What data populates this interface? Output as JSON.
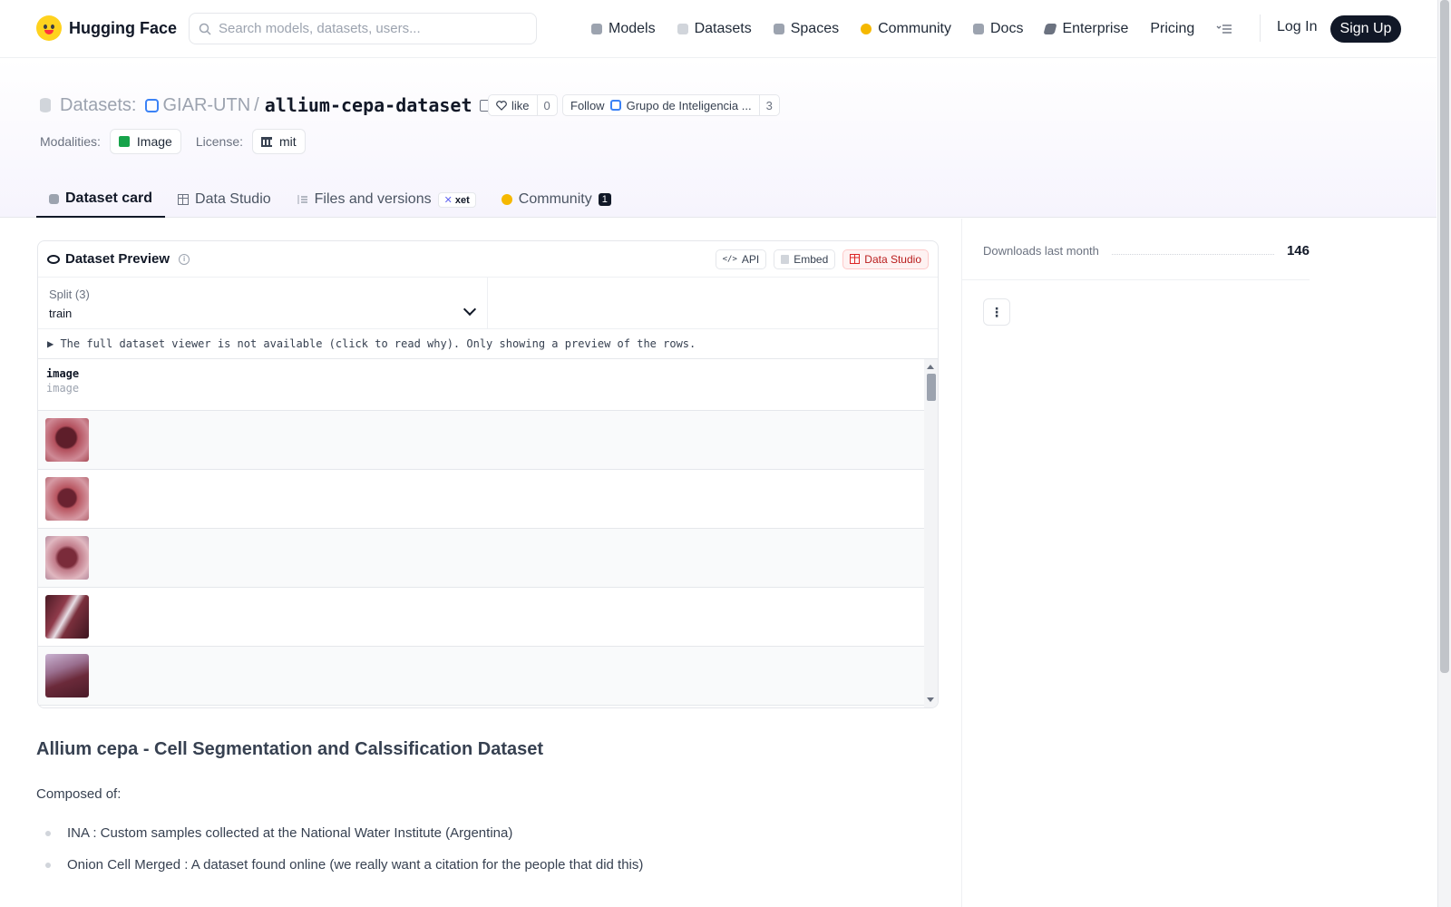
{
  "nav": {
    "brand": "Hugging Face",
    "search_placeholder": "Search models, datasets, users...",
    "links": [
      {
        "label": "Models",
        "icon": "cube-icon",
        "color": "#9ca3af"
      },
      {
        "label": "Datasets",
        "icon": "database-icon",
        "color": "#d1d5db"
      },
      {
        "label": "Spaces",
        "icon": "grid-icon",
        "color": "#9ca3af"
      },
      {
        "label": "Community",
        "icon": "hug-emoji-icon",
        "color": "#f5b800"
      },
      {
        "label": "Docs",
        "icon": "book-icon",
        "color": "#9ca3af"
      },
      {
        "label": "Enterprise",
        "icon": "enterprise-icon",
        "color": "#6b7280"
      },
      {
        "label": "Pricing",
        "icon": "",
        "color": ""
      }
    ],
    "login": "Log In",
    "signup": "Sign Up"
  },
  "header": {
    "section": "Datasets:",
    "org": "GIAR-UTN",
    "sep": "/",
    "repo": "allium-cepa-dataset",
    "like_label": "like",
    "like_count": "0",
    "follow_label": "Follow",
    "follow_org": "Grupo de Inteligencia ...",
    "follow_count": "3",
    "modalities_label": "Modalities:",
    "modality": "Image",
    "license_label": "License:",
    "license": "mit"
  },
  "tabs": [
    {
      "label": "Dataset card",
      "active": true
    },
    {
      "label": "Data Studio"
    },
    {
      "label": "Files and versions",
      "badge": "xet"
    },
    {
      "label": "Community",
      "count": "1"
    }
  ],
  "preview": {
    "title": "Dataset Preview",
    "buttons": [
      "API",
      "Embed",
      "Data Studio"
    ],
    "split_label": "Split (3)",
    "split_value": "train",
    "notice": "▶ The full dataset viewer is not available (click to read why). Only showing a preview of the rows.",
    "column_name": "image",
    "column_type": "image",
    "rows": [
      "#9b3a4a",
      "#a8424f",
      "#b06a7a",
      "#7a3340",
      "#8e6a8f"
    ]
  },
  "readme": {
    "title": "Allium cepa - Cell Segmentation and Calssification Dataset",
    "intro": "Composed of:",
    "items": [
      "INA : Custom samples collected at the National Water Institute (Argentina)",
      "Onion Cell Merged : A dataset found online (we really want a citation for the people that did this)"
    ]
  },
  "sidebar": {
    "downloads_label": "Downloads last month",
    "downloads_value": "146"
  }
}
